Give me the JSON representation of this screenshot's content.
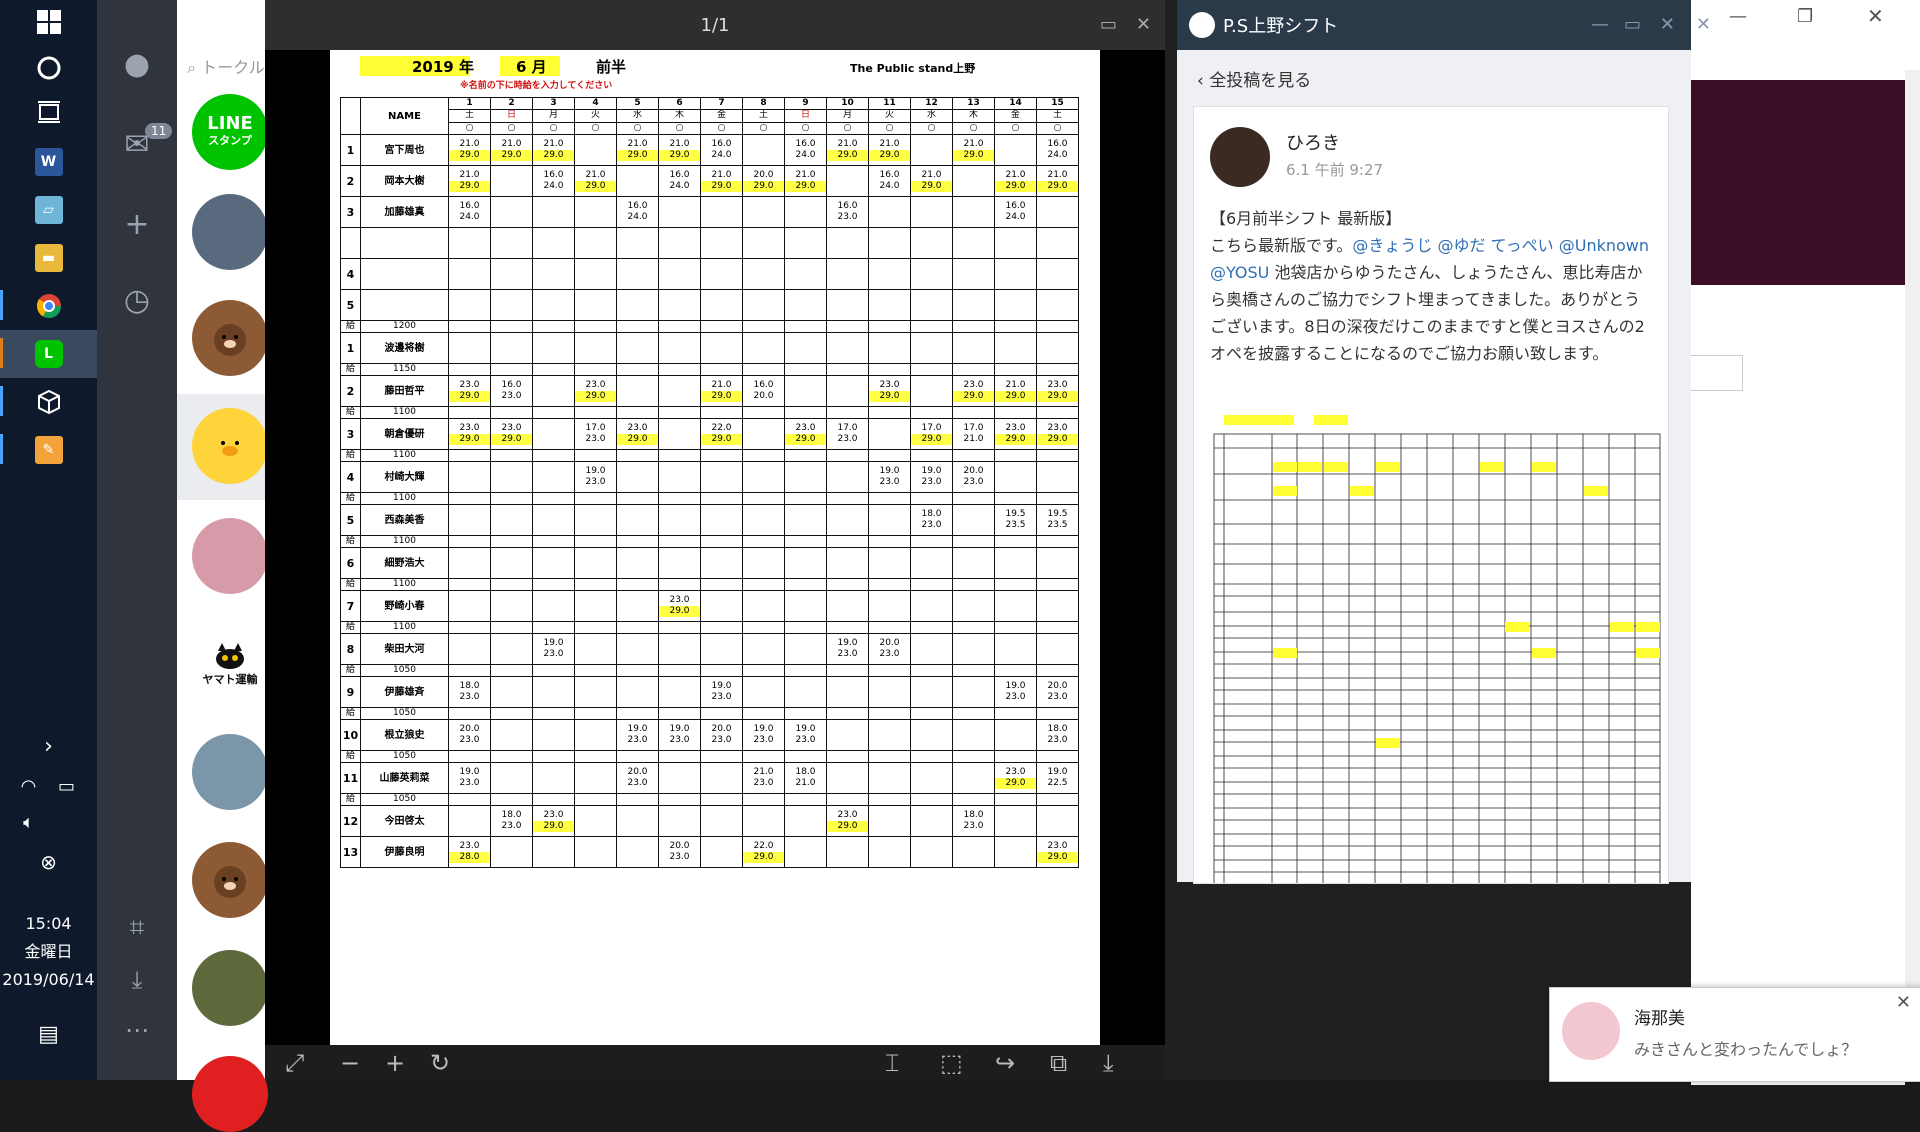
{
  "taskbar": {
    "time": "15:04",
    "weekday": "金曜日",
    "date": "2019/06/14"
  },
  "line_nav": {
    "badge": "11"
  },
  "line_list": {
    "search_placeholder": "トークル",
    "line_stamp_top": "LINE",
    "line_stamp_bottom": "スタンプ",
    "yamato_label": "ヤマト運輸"
  },
  "viewer": {
    "page_indicator": "1/1"
  },
  "sheet": {
    "year_label": "2019 年",
    "month_label": "6 月",
    "half_label": "前半",
    "store_label": "The Public stand上野",
    "note": "※名前の下に時給を入力してください",
    "name_header": "NAME",
    "days": [
      "1",
      "2",
      "3",
      "4",
      "5",
      "6",
      "7",
      "8",
      "9",
      "10",
      "11",
      "12",
      "13",
      "14",
      "15"
    ],
    "weekdays": [
      "土",
      "日",
      "月",
      "火",
      "水",
      "木",
      "金",
      "土",
      "日",
      "月",
      "火",
      "水",
      "木",
      "金",
      "土"
    ],
    "marks": [
      "○",
      "○",
      "○",
      "○",
      "○",
      "○",
      "○",
      "○",
      "○",
      "○",
      "○",
      "○",
      "○",
      "○",
      "○"
    ],
    "rows": [
      {
        "no": "1",
        "name": "宮下周也",
        "wage": "",
        "cells": [
          "21.0|29.0",
          "21.0|29.0",
          "21.0|29.0",
          "",
          "21.0|29.0",
          "21.0|29.0",
          "16.0|24.0",
          "",
          "16.0|24.0",
          "21.0|29.0",
          "21.0|29.0",
          "",
          "21.0|29.0",
          "",
          "16.0|24.0"
        ],
        "hl": [
          1,
          1,
          1,
          0,
          1,
          1,
          0,
          0,
          0,
          1,
          1,
          0,
          1,
          0,
          0
        ]
      },
      {
        "no": "2",
        "name": "岡本大樹",
        "wage": "",
        "cells": [
          "21.0|29.0",
          "",
          "16.0|24.0",
          "21.0|29.0",
          "",
          "16.0|24.0",
          "21.0|29.0",
          "20.0|29.0",
          "21.0|29.0",
          "",
          "16.0|24.0",
          "21.0|29.0",
          "",
          "21.0|29.0",
          "21.0|29.0"
        ],
        "hl": [
          1,
          0,
          0,
          1,
          0,
          0,
          1,
          1,
          1,
          0,
          0,
          1,
          0,
          1,
          1
        ]
      },
      {
        "no": "3",
        "name": "加藤雄真",
        "wage": "",
        "cells": [
          "16.0|24.0",
          "",
          "",
          "",
          "16.0|24.0",
          "",
          "",
          "",
          "",
          "16.0|23.0",
          "",
          "",
          "",
          "16.0|24.0",
          ""
        ],
        "hl": [
          0,
          0,
          0,
          0,
          0,
          0,
          0,
          0,
          0,
          0,
          0,
          0,
          0,
          0,
          0
        ]
      },
      {
        "no": "",
        "name": "",
        "wage": "",
        "cells": [
          "",
          "",
          "",
          "",
          "",
          "",
          "",
          "",
          "",
          "",
          "",
          "",
          "",
          "",
          ""
        ],
        "hl": [
          0,
          0,
          0,
          0,
          0,
          0,
          0,
          0,
          0,
          0,
          0,
          0,
          0,
          0,
          0
        ]
      },
      {
        "no": "4",
        "name": "",
        "wage": "",
        "cells": [
          "",
          "",
          "",
          "",
          "",
          "",
          "",
          "",
          "",
          "",
          "",
          "",
          "",
          "",
          ""
        ],
        "hl": [
          0,
          0,
          0,
          0,
          0,
          0,
          0,
          0,
          0,
          0,
          0,
          0,
          0,
          0,
          0
        ]
      },
      {
        "no": "5",
        "name": "",
        "wage": "",
        "cells": [
          "",
          "",
          "",
          "",
          "",
          "",
          "",
          "",
          "",
          "",
          "",
          "",
          "",
          "",
          ""
        ],
        "hl": [
          0,
          0,
          0,
          0,
          0,
          0,
          0,
          0,
          0,
          0,
          0,
          0,
          0,
          0,
          0
        ]
      },
      {
        "no": "1",
        "name": "波邊将樹",
        "wage": "1200",
        "cells": [
          "",
          "",
          "",
          "",
          "",
          "",
          "",
          "",
          "",
          "",
          "",
          "",
          "",
          "",
          ""
        ],
        "hl": [
          0,
          0,
          0,
          0,
          0,
          0,
          0,
          0,
          0,
          0,
          0,
          0,
          0,
          0,
          0
        ]
      },
      {
        "no": "2",
        "name": "藤田哲平",
        "wage": "1150",
        "cells": [
          "23.0|29.0",
          "16.0|23.0",
          "",
          "23.0|29.0",
          "",
          "",
          "21.0|29.0",
          "16.0|20.0",
          "",
          "",
          "23.0|29.0",
          "",
          "23.0|29.0",
          "21.0|29.0",
          "23.0|29.0"
        ],
        "hl": [
          1,
          0,
          0,
          1,
          0,
          0,
          1,
          0,
          0,
          0,
          1,
          0,
          1,
          1,
          1
        ]
      },
      {
        "no": "3",
        "name": "朝倉優研",
        "wage": "1100",
        "cells": [
          "23.0|29.0",
          "23.0|29.0",
          "",
          "17.0|23.0",
          "23.0|29.0",
          "",
          "22.0|29.0",
          "",
          "23.0|29.0",
          "17.0|23.0",
          "",
          "17.0|29.0",
          "17.0|21.0",
          "23.0|29.0",
          "23.0|29.0"
        ],
        "hl": [
          1,
          1,
          0,
          0,
          1,
          0,
          1,
          0,
          1,
          0,
          0,
          1,
          0,
          1,
          1
        ]
      },
      {
        "no": "4",
        "name": "村崎大輝",
        "wage": "1100",
        "cells": [
          "",
          "",
          "",
          "19.0|23.0",
          "",
          "",
          "",
          "",
          "",
          "",
          "19.0|23.0",
          "19.0|23.0",
          "20.0|23.0",
          "",
          ""
        ],
        "hl": [
          0,
          0,
          0,
          0,
          0,
          0,
          0,
          0,
          0,
          0,
          0,
          0,
          0,
          0,
          0
        ]
      },
      {
        "no": "5",
        "name": "西森美香",
        "wage": "1100",
        "cells": [
          "",
          "",
          "",
          "",
          "",
          "",
          "",
          "",
          "",
          "",
          "",
          "18.0|23.0",
          "",
          "19.5|23.5",
          "19.5|23.5"
        ],
        "hl": [
          0,
          0,
          0,
          0,
          0,
          0,
          0,
          0,
          0,
          0,
          0,
          0,
          0,
          0,
          0
        ]
      },
      {
        "no": "6",
        "name": "細野浩大",
        "wage": "1100",
        "cells": [
          "",
          "",
          "",
          "",
          "",
          "",
          "",
          "",
          "",
          "",
          "",
          "",
          "",
          "",
          ""
        ],
        "hl": [
          0,
          0,
          0,
          0,
          0,
          0,
          0,
          0,
          0,
          0,
          0,
          0,
          0,
          0,
          0
        ]
      },
      {
        "no": "7",
        "name": "野崎小春",
        "wage": "1100",
        "cells": [
          "",
          "",
          "",
          "",
          "",
          "23.0|29.0",
          "",
          "",
          "",
          "",
          "",
          "",
          "",
          "",
          ""
        ],
        "hl": [
          0,
          0,
          0,
          0,
          0,
          1,
          0,
          0,
          0,
          0,
          0,
          0,
          0,
          0,
          0
        ]
      },
      {
        "no": "8",
        "name": "柴田大河",
        "wage": "1100",
        "cells": [
          "",
          "",
          "19.0|23.0",
          "",
          "",
          "",
          "",
          "",
          "",
          "19.0|23.0",
          "20.0|23.0",
          "",
          "",
          "",
          ""
        ],
        "hl": [
          0,
          0,
          0,
          0,
          0,
          0,
          0,
          0,
          0,
          0,
          0,
          0,
          0,
          0,
          0
        ]
      },
      {
        "no": "9",
        "name": "伊藤雄斉",
        "wage": "1050",
        "cells": [
          "18.0|23.0",
          "",
          "",
          "",
          "",
          "",
          "19.0|23.0",
          "",
          "",
          "",
          "",
          "",
          "",
          "19.0|23.0",
          "20.0|23.0"
        ],
        "hl": [
          0,
          0,
          0,
          0,
          0,
          0,
          0,
          0,
          0,
          0,
          0,
          0,
          0,
          0,
          0
        ]
      },
      {
        "no": "10",
        "name": "根立狼史",
        "wage": "1050",
        "cells": [
          "20.0|23.0",
          "",
          "",
          "",
          "19.0|23.0",
          "19.0|23.0",
          "20.0|23.0",
          "19.0|23.0",
          "19.0|23.0",
          "",
          "",
          "",
          "",
          "",
          "18.0|23.0"
        ],
        "hl": [
          0,
          0,
          0,
          0,
          0,
          0,
          0,
          0,
          0,
          0,
          0,
          0,
          0,
          0,
          0
        ]
      },
      {
        "no": "11",
        "name": "山藤英莉菜",
        "wage": "1050",
        "cells": [
          "19.0|23.0",
          "",
          "",
          "",
          "20.0|23.0",
          "",
          "",
          "21.0|23.0",
          "18.0|21.0",
          "",
          "",
          "",
          "",
          "23.0|29.0",
          "19.0|22.5"
        ],
        "hl": [
          0,
          0,
          0,
          0,
          0,
          0,
          0,
          0,
          0,
          0,
          0,
          0,
          0,
          1,
          0
        ]
      },
      {
        "no": "12",
        "name": "今田啓太",
        "wage": "1050",
        "cells": [
          "",
          "18.0|23.0",
          "23.0|29.0",
          "",
          "",
          "",
          "",
          "",
          "",
          "23.0|29.0",
          "",
          "",
          "18.0|23.0",
          "",
          ""
        ],
        "hl": [
          0,
          0,
          1,
          0,
          0,
          0,
          0,
          0,
          0,
          1,
          0,
          0,
          0,
          0,
          0
        ]
      },
      {
        "no": "13",
        "name": "伊藤良明",
        "wage": "",
        "cells": [
          "23.0|28.0",
          "",
          "",
          "",
          "",
          "20.0|23.0",
          "",
          "22.0|29.0",
          "",
          "",
          "",
          "",
          "",
          "",
          "23.0|29.0"
        ],
        "hl": [
          1,
          0,
          0,
          0,
          0,
          0,
          0,
          1,
          0,
          0,
          0,
          0,
          0,
          0,
          1
        ]
      }
    ]
  },
  "post_window": {
    "title": "P.S上野シフト",
    "back_label": "全投稿を見る",
    "author": "ひろき",
    "time": "6.1 午前 9:27",
    "body_line1": "【6月前半シフト 最新版】",
    "body_prefix": "こちら最新版です。",
    "mention1": "@きょうじ",
    "mention2": "@ゆだ てっぺい",
    "mention3": "@Unknown",
    "mention4": "@YOSU",
    "body_rest": "池袋店からゆうたさん、しょうたさん、恵比寿店から奥橋さんのご協力でシフト埋まってきました。ありがとうございます。8日の深夜だけこのままですと僕とヨスさんの2オペを披露することになるのでご協力お願い致します。"
  },
  "notification": {
    "name": "海那美",
    "message": "みきさんと変わったんでしょ？"
  }
}
